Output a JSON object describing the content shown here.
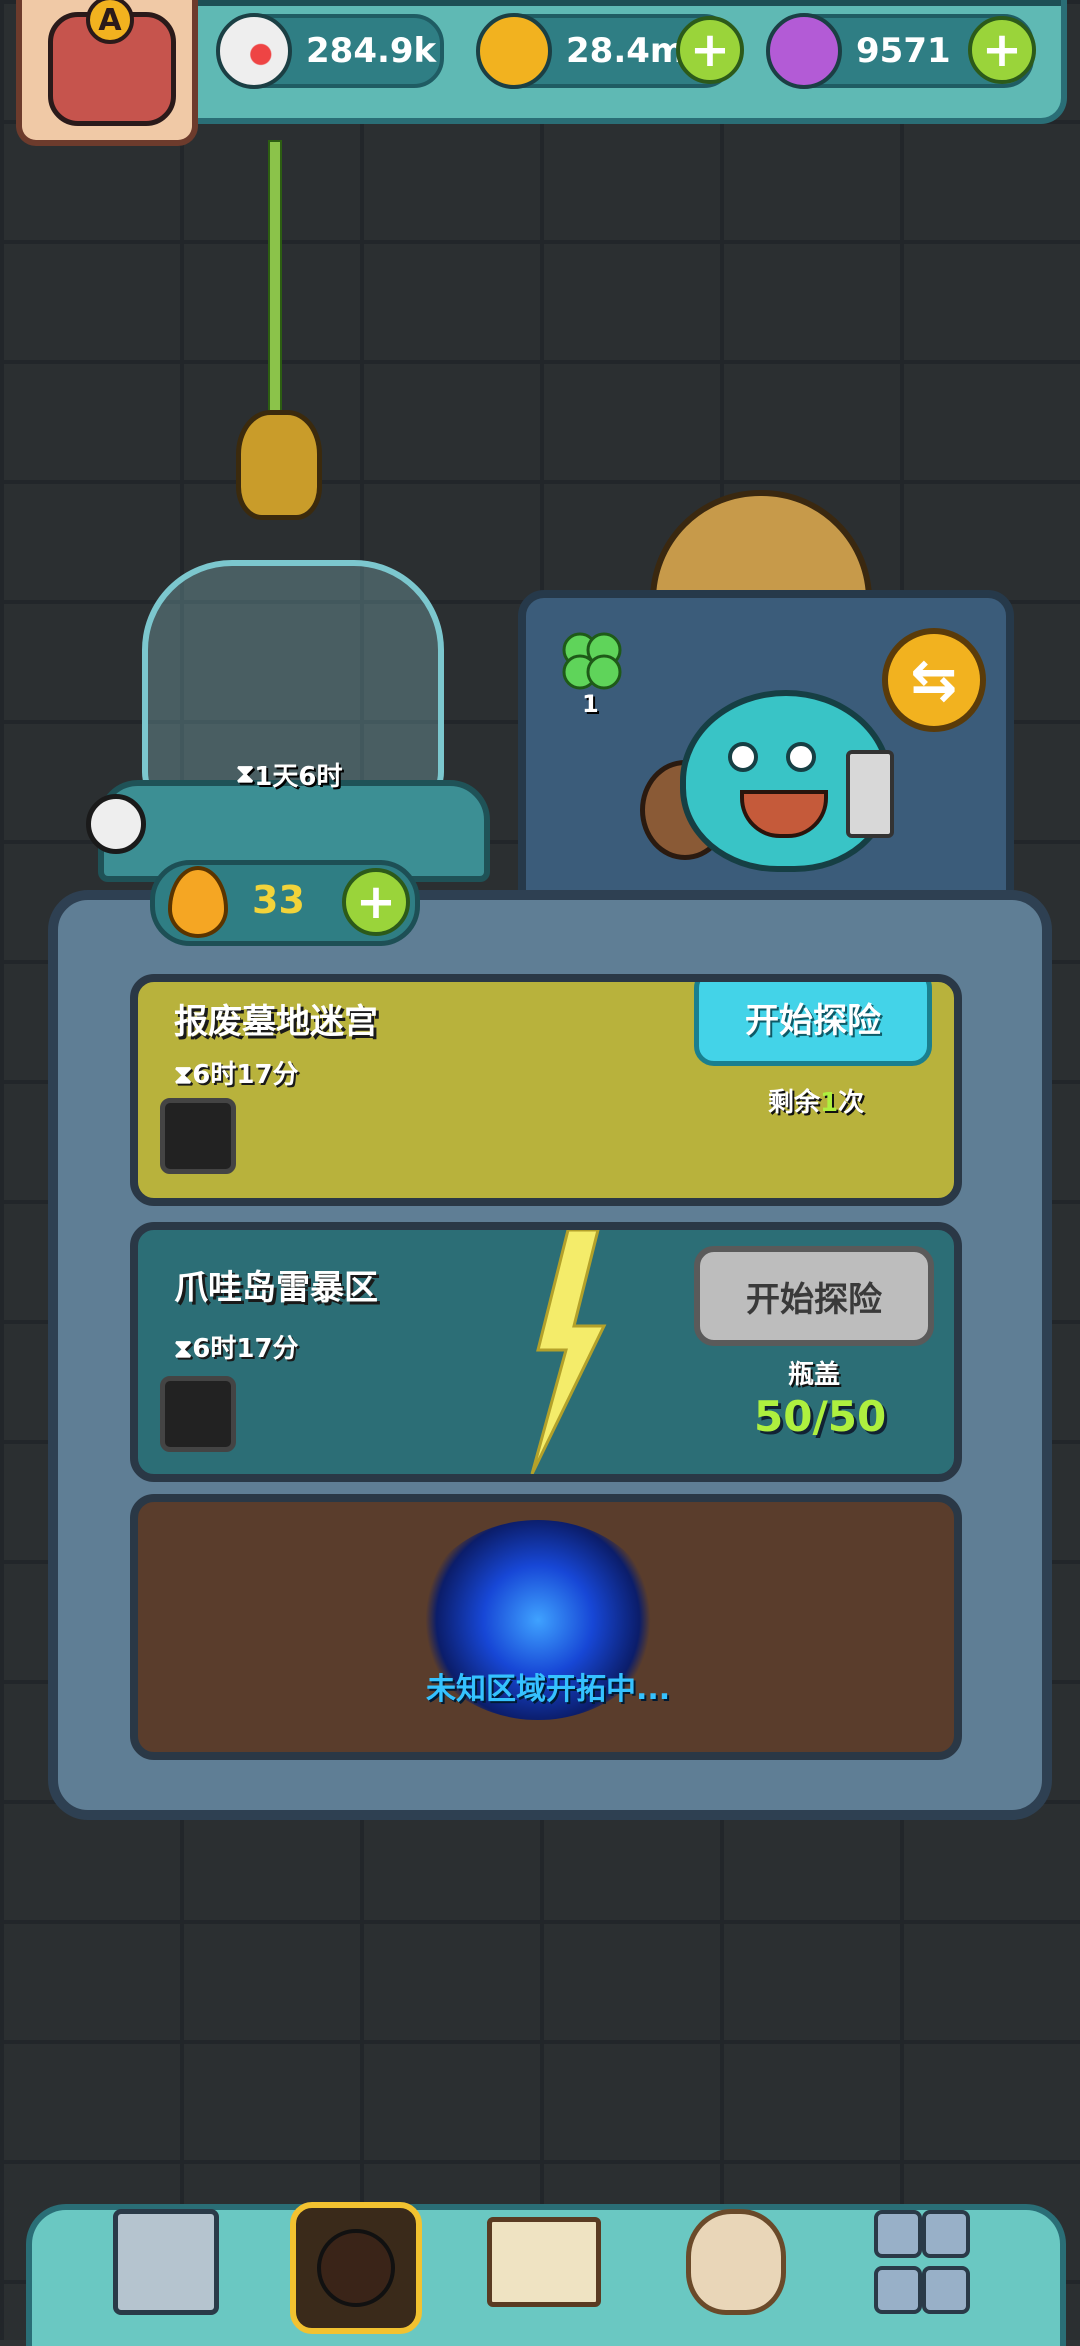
{
  "colors": {
    "background": "#2f3335",
    "topbar": "#5fb9b4",
    "accent_green": "#9ad43a",
    "button_cyan": "#43d3e8",
    "button_gray": "#bdbdbd",
    "capacity_green": "#aef03f",
    "unknown_blue": "#35c2ff"
  },
  "header": {
    "avatar_badge": "A",
    "resources": [
      {
        "icon": "eyeball-icon",
        "value": "284.9k"
      },
      {
        "icon": "gold-coin-icon",
        "value": "28.4m"
      },
      {
        "icon": "purple-potion-icon",
        "value": "9571"
      }
    ]
  },
  "incubator": {
    "timer": "1天6时"
  },
  "pet": {
    "clover_count": "1"
  },
  "energy": {
    "value": "33"
  },
  "expeditions": [
    {
      "title": "报废墓地迷宫",
      "time": "6时17分",
      "button_label": "开始探险",
      "remaining_prefix": "剩余",
      "remaining_count": "1",
      "remaining_suffix": "次"
    },
    {
      "title": "爪哇岛雷暴区",
      "time": "6时17分",
      "button_label": "开始探险",
      "capacity_label": "瓶盖",
      "capacity_value": "50/50"
    }
  ],
  "unknown_area": {
    "label": "未知区域开拓中..."
  },
  "bottom_nav": [
    {
      "icon": "shop-building-icon"
    },
    {
      "icon": "monster-den-icon",
      "selected": true
    },
    {
      "icon": "book-icon"
    },
    {
      "icon": "money-bag-icon"
    },
    {
      "icon": "grid-menu-icon"
    }
  ]
}
